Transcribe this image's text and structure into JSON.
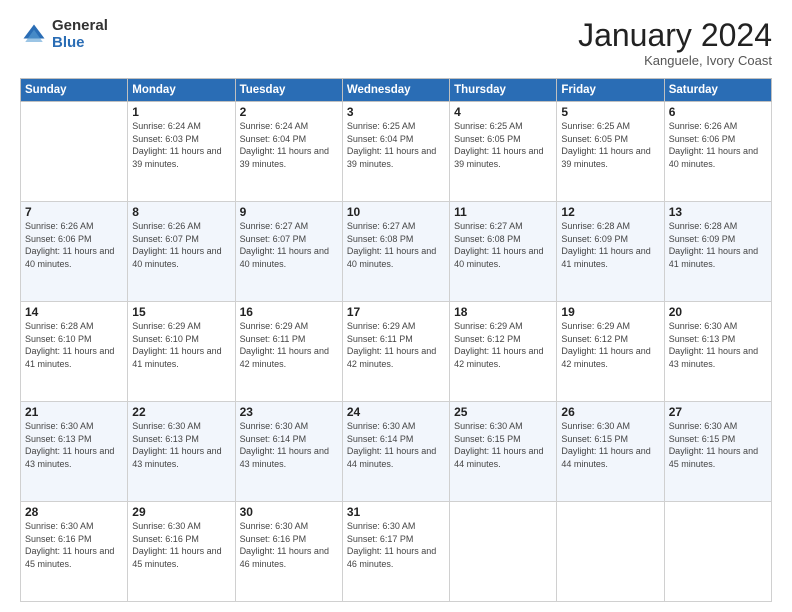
{
  "header": {
    "logo_general": "General",
    "logo_blue": "Blue",
    "month_title": "January 2024",
    "subtitle": "Kanguele, Ivory Coast"
  },
  "weekdays": [
    "Sunday",
    "Monday",
    "Tuesday",
    "Wednesday",
    "Thursday",
    "Friday",
    "Saturday"
  ],
  "weeks": [
    [
      {
        "day": "",
        "empty": true
      },
      {
        "day": "1",
        "sunrise": "Sunrise: 6:24 AM",
        "sunset": "Sunset: 6:03 PM",
        "daylight": "Daylight: 11 hours and 39 minutes."
      },
      {
        "day": "2",
        "sunrise": "Sunrise: 6:24 AM",
        "sunset": "Sunset: 6:04 PM",
        "daylight": "Daylight: 11 hours and 39 minutes."
      },
      {
        "day": "3",
        "sunrise": "Sunrise: 6:25 AM",
        "sunset": "Sunset: 6:04 PM",
        "daylight": "Daylight: 11 hours and 39 minutes."
      },
      {
        "day": "4",
        "sunrise": "Sunrise: 6:25 AM",
        "sunset": "Sunset: 6:05 PM",
        "daylight": "Daylight: 11 hours and 39 minutes."
      },
      {
        "day": "5",
        "sunrise": "Sunrise: 6:25 AM",
        "sunset": "Sunset: 6:05 PM",
        "daylight": "Daylight: 11 hours and 39 minutes."
      },
      {
        "day": "6",
        "sunrise": "Sunrise: 6:26 AM",
        "sunset": "Sunset: 6:06 PM",
        "daylight": "Daylight: 11 hours and 40 minutes."
      }
    ],
    [
      {
        "day": "7",
        "sunrise": "Sunrise: 6:26 AM",
        "sunset": "Sunset: 6:06 PM",
        "daylight": "Daylight: 11 hours and 40 minutes."
      },
      {
        "day": "8",
        "sunrise": "Sunrise: 6:26 AM",
        "sunset": "Sunset: 6:07 PM",
        "daylight": "Daylight: 11 hours and 40 minutes."
      },
      {
        "day": "9",
        "sunrise": "Sunrise: 6:27 AM",
        "sunset": "Sunset: 6:07 PM",
        "daylight": "Daylight: 11 hours and 40 minutes."
      },
      {
        "day": "10",
        "sunrise": "Sunrise: 6:27 AM",
        "sunset": "Sunset: 6:08 PM",
        "daylight": "Daylight: 11 hours and 40 minutes."
      },
      {
        "day": "11",
        "sunrise": "Sunrise: 6:27 AM",
        "sunset": "Sunset: 6:08 PM",
        "daylight": "Daylight: 11 hours and 40 minutes."
      },
      {
        "day": "12",
        "sunrise": "Sunrise: 6:28 AM",
        "sunset": "Sunset: 6:09 PM",
        "daylight": "Daylight: 11 hours and 41 minutes."
      },
      {
        "day": "13",
        "sunrise": "Sunrise: 6:28 AM",
        "sunset": "Sunset: 6:09 PM",
        "daylight": "Daylight: 11 hours and 41 minutes."
      }
    ],
    [
      {
        "day": "14",
        "sunrise": "Sunrise: 6:28 AM",
        "sunset": "Sunset: 6:10 PM",
        "daylight": "Daylight: 11 hours and 41 minutes."
      },
      {
        "day": "15",
        "sunrise": "Sunrise: 6:29 AM",
        "sunset": "Sunset: 6:10 PM",
        "daylight": "Daylight: 11 hours and 41 minutes."
      },
      {
        "day": "16",
        "sunrise": "Sunrise: 6:29 AM",
        "sunset": "Sunset: 6:11 PM",
        "daylight": "Daylight: 11 hours and 42 minutes."
      },
      {
        "day": "17",
        "sunrise": "Sunrise: 6:29 AM",
        "sunset": "Sunset: 6:11 PM",
        "daylight": "Daylight: 11 hours and 42 minutes."
      },
      {
        "day": "18",
        "sunrise": "Sunrise: 6:29 AM",
        "sunset": "Sunset: 6:12 PM",
        "daylight": "Daylight: 11 hours and 42 minutes."
      },
      {
        "day": "19",
        "sunrise": "Sunrise: 6:29 AM",
        "sunset": "Sunset: 6:12 PM",
        "daylight": "Daylight: 11 hours and 42 minutes."
      },
      {
        "day": "20",
        "sunrise": "Sunrise: 6:30 AM",
        "sunset": "Sunset: 6:13 PM",
        "daylight": "Daylight: 11 hours and 43 minutes."
      }
    ],
    [
      {
        "day": "21",
        "sunrise": "Sunrise: 6:30 AM",
        "sunset": "Sunset: 6:13 PM",
        "daylight": "Daylight: 11 hours and 43 minutes."
      },
      {
        "day": "22",
        "sunrise": "Sunrise: 6:30 AM",
        "sunset": "Sunset: 6:13 PM",
        "daylight": "Daylight: 11 hours and 43 minutes."
      },
      {
        "day": "23",
        "sunrise": "Sunrise: 6:30 AM",
        "sunset": "Sunset: 6:14 PM",
        "daylight": "Daylight: 11 hours and 43 minutes."
      },
      {
        "day": "24",
        "sunrise": "Sunrise: 6:30 AM",
        "sunset": "Sunset: 6:14 PM",
        "daylight": "Daylight: 11 hours and 44 minutes."
      },
      {
        "day": "25",
        "sunrise": "Sunrise: 6:30 AM",
        "sunset": "Sunset: 6:15 PM",
        "daylight": "Daylight: 11 hours and 44 minutes."
      },
      {
        "day": "26",
        "sunrise": "Sunrise: 6:30 AM",
        "sunset": "Sunset: 6:15 PM",
        "daylight": "Daylight: 11 hours and 44 minutes."
      },
      {
        "day": "27",
        "sunrise": "Sunrise: 6:30 AM",
        "sunset": "Sunset: 6:15 PM",
        "daylight": "Daylight: 11 hours and 45 minutes."
      }
    ],
    [
      {
        "day": "28",
        "sunrise": "Sunrise: 6:30 AM",
        "sunset": "Sunset: 6:16 PM",
        "daylight": "Daylight: 11 hours and 45 minutes."
      },
      {
        "day": "29",
        "sunrise": "Sunrise: 6:30 AM",
        "sunset": "Sunset: 6:16 PM",
        "daylight": "Daylight: 11 hours and 45 minutes."
      },
      {
        "day": "30",
        "sunrise": "Sunrise: 6:30 AM",
        "sunset": "Sunset: 6:16 PM",
        "daylight": "Daylight: 11 hours and 46 minutes."
      },
      {
        "day": "31",
        "sunrise": "Sunrise: 6:30 AM",
        "sunset": "Sunset: 6:17 PM",
        "daylight": "Daylight: 11 hours and 46 minutes."
      },
      {
        "day": "",
        "empty": true
      },
      {
        "day": "",
        "empty": true
      },
      {
        "day": "",
        "empty": true
      }
    ]
  ]
}
